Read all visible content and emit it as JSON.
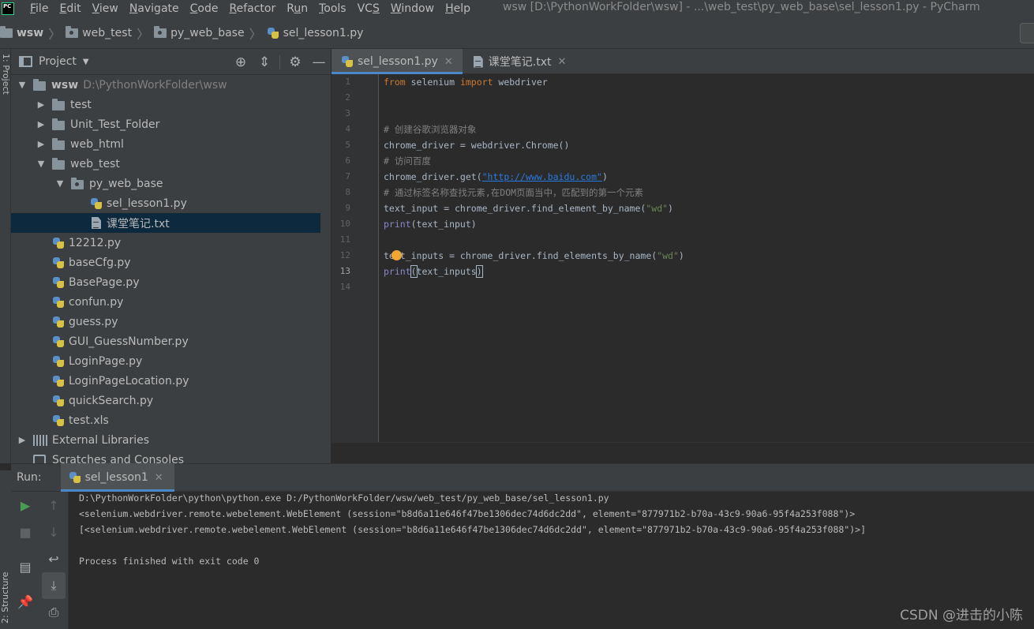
{
  "app_logo": "PC",
  "menu": [
    {
      "pre": "",
      "u": "F",
      "post": "ile"
    },
    {
      "pre": "",
      "u": "E",
      "post": "dit"
    },
    {
      "pre": "",
      "u": "V",
      "post": "iew"
    },
    {
      "pre": "",
      "u": "N",
      "post": "avigate"
    },
    {
      "pre": "",
      "u": "C",
      "post": "ode"
    },
    {
      "pre": "",
      "u": "R",
      "post": "efactor"
    },
    {
      "pre": "R",
      "u": "u",
      "post": "n"
    },
    {
      "pre": "",
      "u": "T",
      "post": "ools"
    },
    {
      "pre": "VC",
      "u": "S",
      "post": ""
    },
    {
      "pre": "",
      "u": "W",
      "post": "indow"
    },
    {
      "pre": "",
      "u": "H",
      "post": "elp"
    }
  ],
  "window_title": "wsw [D:\\PythonWorkFolder\\wsw] - ...\\web_test\\py_web_base\\sel_lesson1.py - PyCharm",
  "breadcrumb": [
    "wsw",
    "web_test",
    "py_web_base",
    "sel_lesson1.py"
  ],
  "left_strip_label": "1: Project",
  "left_strip_bottom_label": "2: Structure",
  "project": {
    "header_title": "Project",
    "tree": [
      {
        "indent": 0,
        "arrow": "▼",
        "icon": "folder",
        "label": "wsw",
        "bold": true,
        "path": "D:\\PythonWorkFolder\\wsw"
      },
      {
        "indent": 1,
        "arrow": "▶",
        "icon": "folder",
        "label": "test"
      },
      {
        "indent": 1,
        "arrow": "▶",
        "icon": "folder",
        "label": "Unit_Test_Folder"
      },
      {
        "indent": 1,
        "arrow": "▶",
        "icon": "folder",
        "label": "web_html"
      },
      {
        "indent": 1,
        "arrow": "▼",
        "icon": "folder",
        "label": "web_test"
      },
      {
        "indent": 2,
        "arrow": "▼",
        "icon": "folder",
        "label": "py_web_base"
      },
      {
        "indent": 3,
        "arrow": "",
        "icon": "py",
        "label": "sel_lesson1.py"
      },
      {
        "indent": 3,
        "arrow": "",
        "icon": "txt",
        "label": "课堂笔记.txt",
        "selected": true
      },
      {
        "indent": 1,
        "arrow": "",
        "icon": "py",
        "label": "12212.py"
      },
      {
        "indent": 1,
        "arrow": "",
        "icon": "py",
        "label": "baseCfg.py"
      },
      {
        "indent": 1,
        "arrow": "",
        "icon": "py",
        "label": "BasePage.py"
      },
      {
        "indent": 1,
        "arrow": "",
        "icon": "py",
        "label": "confun.py"
      },
      {
        "indent": 1,
        "arrow": "",
        "icon": "py",
        "label": "guess.py"
      },
      {
        "indent": 1,
        "arrow": "",
        "icon": "py",
        "label": "GUI_GuessNumber.py"
      },
      {
        "indent": 1,
        "arrow": "",
        "icon": "py",
        "label": "LoginPage.py"
      },
      {
        "indent": 1,
        "arrow": "",
        "icon": "py",
        "label": "LoginPageLocation.py"
      },
      {
        "indent": 1,
        "arrow": "",
        "icon": "py",
        "label": "quickSearch.py"
      },
      {
        "indent": 1,
        "arrow": "",
        "icon": "py",
        "label": "test.xls"
      },
      {
        "indent": 0,
        "arrow": "▶",
        "icon": "lib",
        "label": "External Libraries"
      },
      {
        "indent": 0,
        "arrow": "",
        "icon": "scratch",
        "label": "Scratches and Consoles"
      }
    ]
  },
  "editor": {
    "tabs": [
      {
        "label": "sel_lesson1.py",
        "icon": "py",
        "active": true
      },
      {
        "label": "课堂笔记.txt",
        "icon": "txt",
        "active": false
      }
    ],
    "current_line": 13,
    "lines": [
      [
        [
          "kw",
          "from"
        ],
        [
          "",
          " selenium "
        ],
        [
          "kw",
          "import"
        ],
        [
          "",
          " webdriver"
        ]
      ],
      [],
      [],
      [
        [
          "cm",
          "# 创建谷歌浏览器对象"
        ]
      ],
      [
        [
          "",
          "chrome_driver = webdriver.Chrome()"
        ]
      ],
      [
        [
          "cm",
          "# 访问百度"
        ]
      ],
      [
        [
          "",
          "chrome_driver.get("
        ],
        [
          "url",
          "\"http://www.baidu.com\""
        ],
        [
          "",
          ")"
        ]
      ],
      [
        [
          "cm",
          "# 通过标签名称查找元素,在DOM页面当中，匹配到的第一个元素"
        ]
      ],
      [
        [
          "",
          "text_input = chrome_driver.find_element_by_name("
        ],
        [
          "str",
          "\"wd\""
        ],
        [
          "",
          ")"
        ]
      ],
      [
        [
          "fn",
          "print"
        ],
        [
          "",
          "(text_input)"
        ]
      ],
      [],
      [
        [
          "",
          "text_inputs = chrome_driver.find_elements_by_name("
        ],
        [
          "str",
          "\"wd\""
        ],
        [
          "",
          ")"
        ]
      ],
      [
        [
          "fn",
          "print"
        ],
        [
          "caret-match",
          "("
        ],
        [
          "",
          "text_inputs"
        ],
        [
          "caret-match",
          ")"
        ]
      ],
      []
    ]
  },
  "run": {
    "label": "Run:",
    "tab_label": "sel_lesson1",
    "console": [
      "D:\\PythonWorkFolder\\python\\python.exe D:/PythonWorkFolder/wsw/web_test/py_web_base/sel_lesson1.py",
      "<selenium.webdriver.remote.webelement.WebElement (session=\"b8d6a11e646f47be1306dec74d6dc2dd\", element=\"877971b2-b70a-43c9-90a6-95f4a253f088\")>",
      "[<selenium.webdriver.remote.webelement.WebElement (session=\"b8d6a11e646f47be1306dec74d6dc2dd\", element=\"877971b2-b70a-43c9-90a6-95f4a253f088\")>]",
      "",
      "Process finished with exit code 0"
    ]
  },
  "watermark": "CSDN @进击的小陈"
}
